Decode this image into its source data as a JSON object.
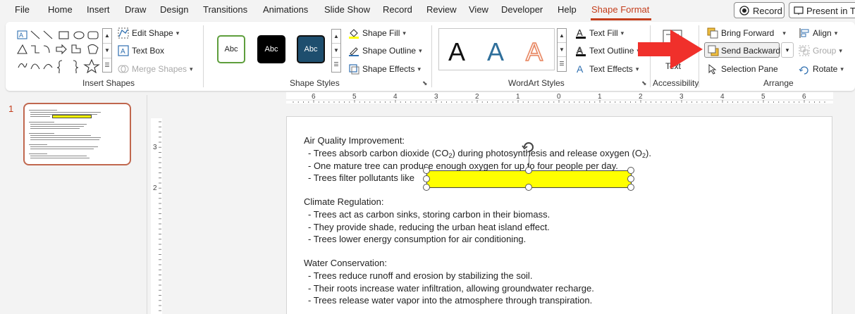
{
  "menu": {
    "items": [
      "File",
      "Home",
      "Insert",
      "Draw",
      "Design",
      "Transitions",
      "Animations",
      "Slide Show",
      "Record",
      "Review",
      "View",
      "Developer",
      "Help",
      "Shape Format"
    ],
    "active": "Shape Format",
    "record_label": "Record",
    "present_label": "Present in Te"
  },
  "ribbon": {
    "insert_shapes": {
      "label": "Insert Shapes",
      "edit_shape": "Edit Shape",
      "text_box": "Text Box",
      "merge_shapes": "Merge Shapes"
    },
    "shape_styles": {
      "label": "Shape Styles",
      "swatch_text": "Abc",
      "shape_fill": "Shape Fill",
      "shape_outline": "Shape Outline",
      "shape_effects": "Shape Effects"
    },
    "wordart_styles": {
      "label": "WordArt Styles",
      "letter": "A",
      "text_fill": "Text Fill",
      "text_outline": "Text Outline",
      "text_effects": "Text Effects"
    },
    "accessibility": {
      "label": "Accessibility",
      "alt_text": "Text"
    },
    "arrange": {
      "label": "Arrange",
      "bring_forward": "Bring Forward",
      "send_backward": "Send Backward",
      "selection_pane": "Selection Pane",
      "align": "Align",
      "group": "Group",
      "rotate": "Rotate"
    }
  },
  "thumbnails": {
    "slide_number": "1"
  },
  "rulers": {
    "horizontal": [
      "6",
      "5",
      "4",
      "3",
      "2",
      "1",
      "0",
      "1",
      "2",
      "3",
      "4",
      "5",
      "6"
    ],
    "vertical": [
      "3",
      "2"
    ]
  },
  "slide": {
    "sections": [
      {
        "heading": "Air Quality Improvement:",
        "lines": [
          {
            "pre": "- Trees absorb carbon dioxide (CO",
            "sub": "2",
            "mid": ") during photosynthesis and release oxygen (O",
            "sub2": "2",
            "post": ")."
          },
          {
            "text": "- One mature tree can produce enough oxygen for up to four people per day."
          },
          {
            "text": "- Trees filter pollutants like"
          }
        ]
      },
      {
        "heading": "Climate Regulation:",
        "lines": [
          {
            "text": "- Trees act as carbon sinks, storing carbon in their biomass."
          },
          {
            "text": "- They provide shade, reducing the urban heat island effect."
          },
          {
            "text": "- Trees lower energy consumption for air conditioning."
          }
        ]
      },
      {
        "heading": "Water Conservation:",
        "lines": [
          {
            "text": "- Trees reduce runoff and erosion by stabilizing the soil."
          },
          {
            "text": "- Their roots increase water infiltration, allowing groundwater recharge."
          },
          {
            "text": "- Trees release water vapor into the atmosphere through transpiration."
          }
        ]
      }
    ]
  },
  "colors": {
    "accent": "#c43e1c",
    "shape_fill": "#ffff00",
    "arrow": "#f0302b",
    "swatch_1_border": "#5e9e3c",
    "swatch_2": "#000000",
    "swatch_3": "#1e4e6e",
    "wordart_black": "#111111",
    "wordart_blue": "#2f6f9b",
    "wordart_orange": "#f0a080"
  }
}
